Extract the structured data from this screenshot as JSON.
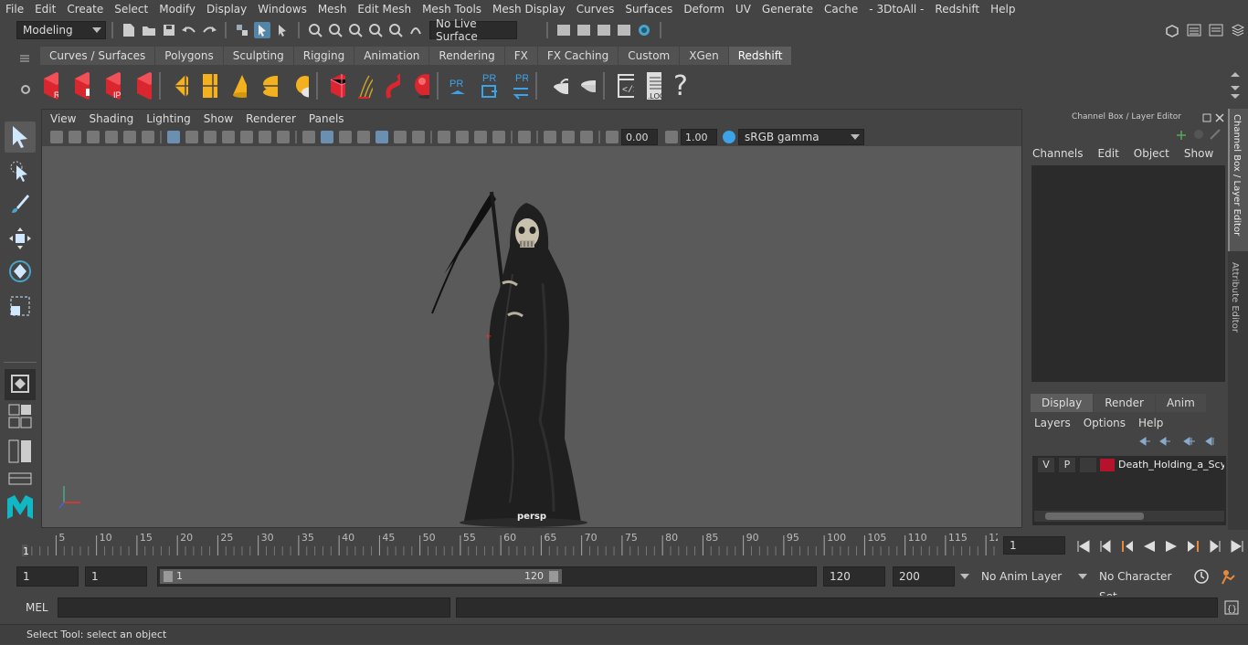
{
  "menubar": [
    "File",
    "Edit",
    "Create",
    "Select",
    "Modify",
    "Display",
    "Windows",
    "Mesh",
    "Edit Mesh",
    "Mesh Tools",
    "Mesh Display",
    "Curves",
    "Surfaces",
    "Deform",
    "UV",
    "Generate",
    "Cache",
    "- 3DtoAll -",
    "Redshift",
    "Help"
  ],
  "status": {
    "mode": "Modeling",
    "live_surface": "No Live Surface"
  },
  "shelf_tabs": [
    "Curves / Surfaces",
    "Polygons",
    "Sculpting",
    "Rigging",
    "Animation",
    "Rendering",
    "FX",
    "FX Caching",
    "Custom",
    "XGen",
    "Redshift"
  ],
  "shelf_labels": {
    "rv": "RV",
    "ipr": "IPR",
    "pr": "PR",
    "log": ".LOG",
    "help": "?"
  },
  "viewport": {
    "menus": [
      "View",
      "Shading",
      "Lighting",
      "Show",
      "Renderer",
      "Panels"
    ],
    "exposure": "0.00",
    "gamma": "1.00",
    "colorspace": "sRGB gamma",
    "camera": "persp"
  },
  "channel_box": {
    "title": "Channel Box / Layer Editor",
    "menus": [
      "Channels",
      "Edit",
      "Object",
      "Show"
    ],
    "tabs": [
      "Display",
      "Render",
      "Anim"
    ],
    "layer_menus": [
      "Layers",
      "Options",
      "Help"
    ],
    "layer": {
      "v": "V",
      "p": "P",
      "name": "Death_Holding_a_Scyt",
      "color": "#b5132b"
    }
  },
  "side_tabs": [
    "Channel Box / Layer Editor",
    "Attribute Editor"
  ],
  "timeline": {
    "ticks": [
      "5",
      "10",
      "15",
      "20",
      "25",
      "30",
      "35",
      "40",
      "45",
      "50",
      "55",
      "60",
      "65",
      "70",
      "75",
      "80",
      "85",
      "90",
      "95",
      "100",
      "105",
      "110",
      "115",
      "12"
    ],
    "start_label": "1",
    "current": "1"
  },
  "range": {
    "start": "1",
    "playback_start": "1",
    "slider_start": "1",
    "slider_end": "120",
    "end": "120",
    "anim_end": "200",
    "anim_layer": "No Anim Layer",
    "char_set": "No Character Set"
  },
  "cmd": {
    "label": "MEL"
  },
  "help_line": "Select Tool: select an object"
}
